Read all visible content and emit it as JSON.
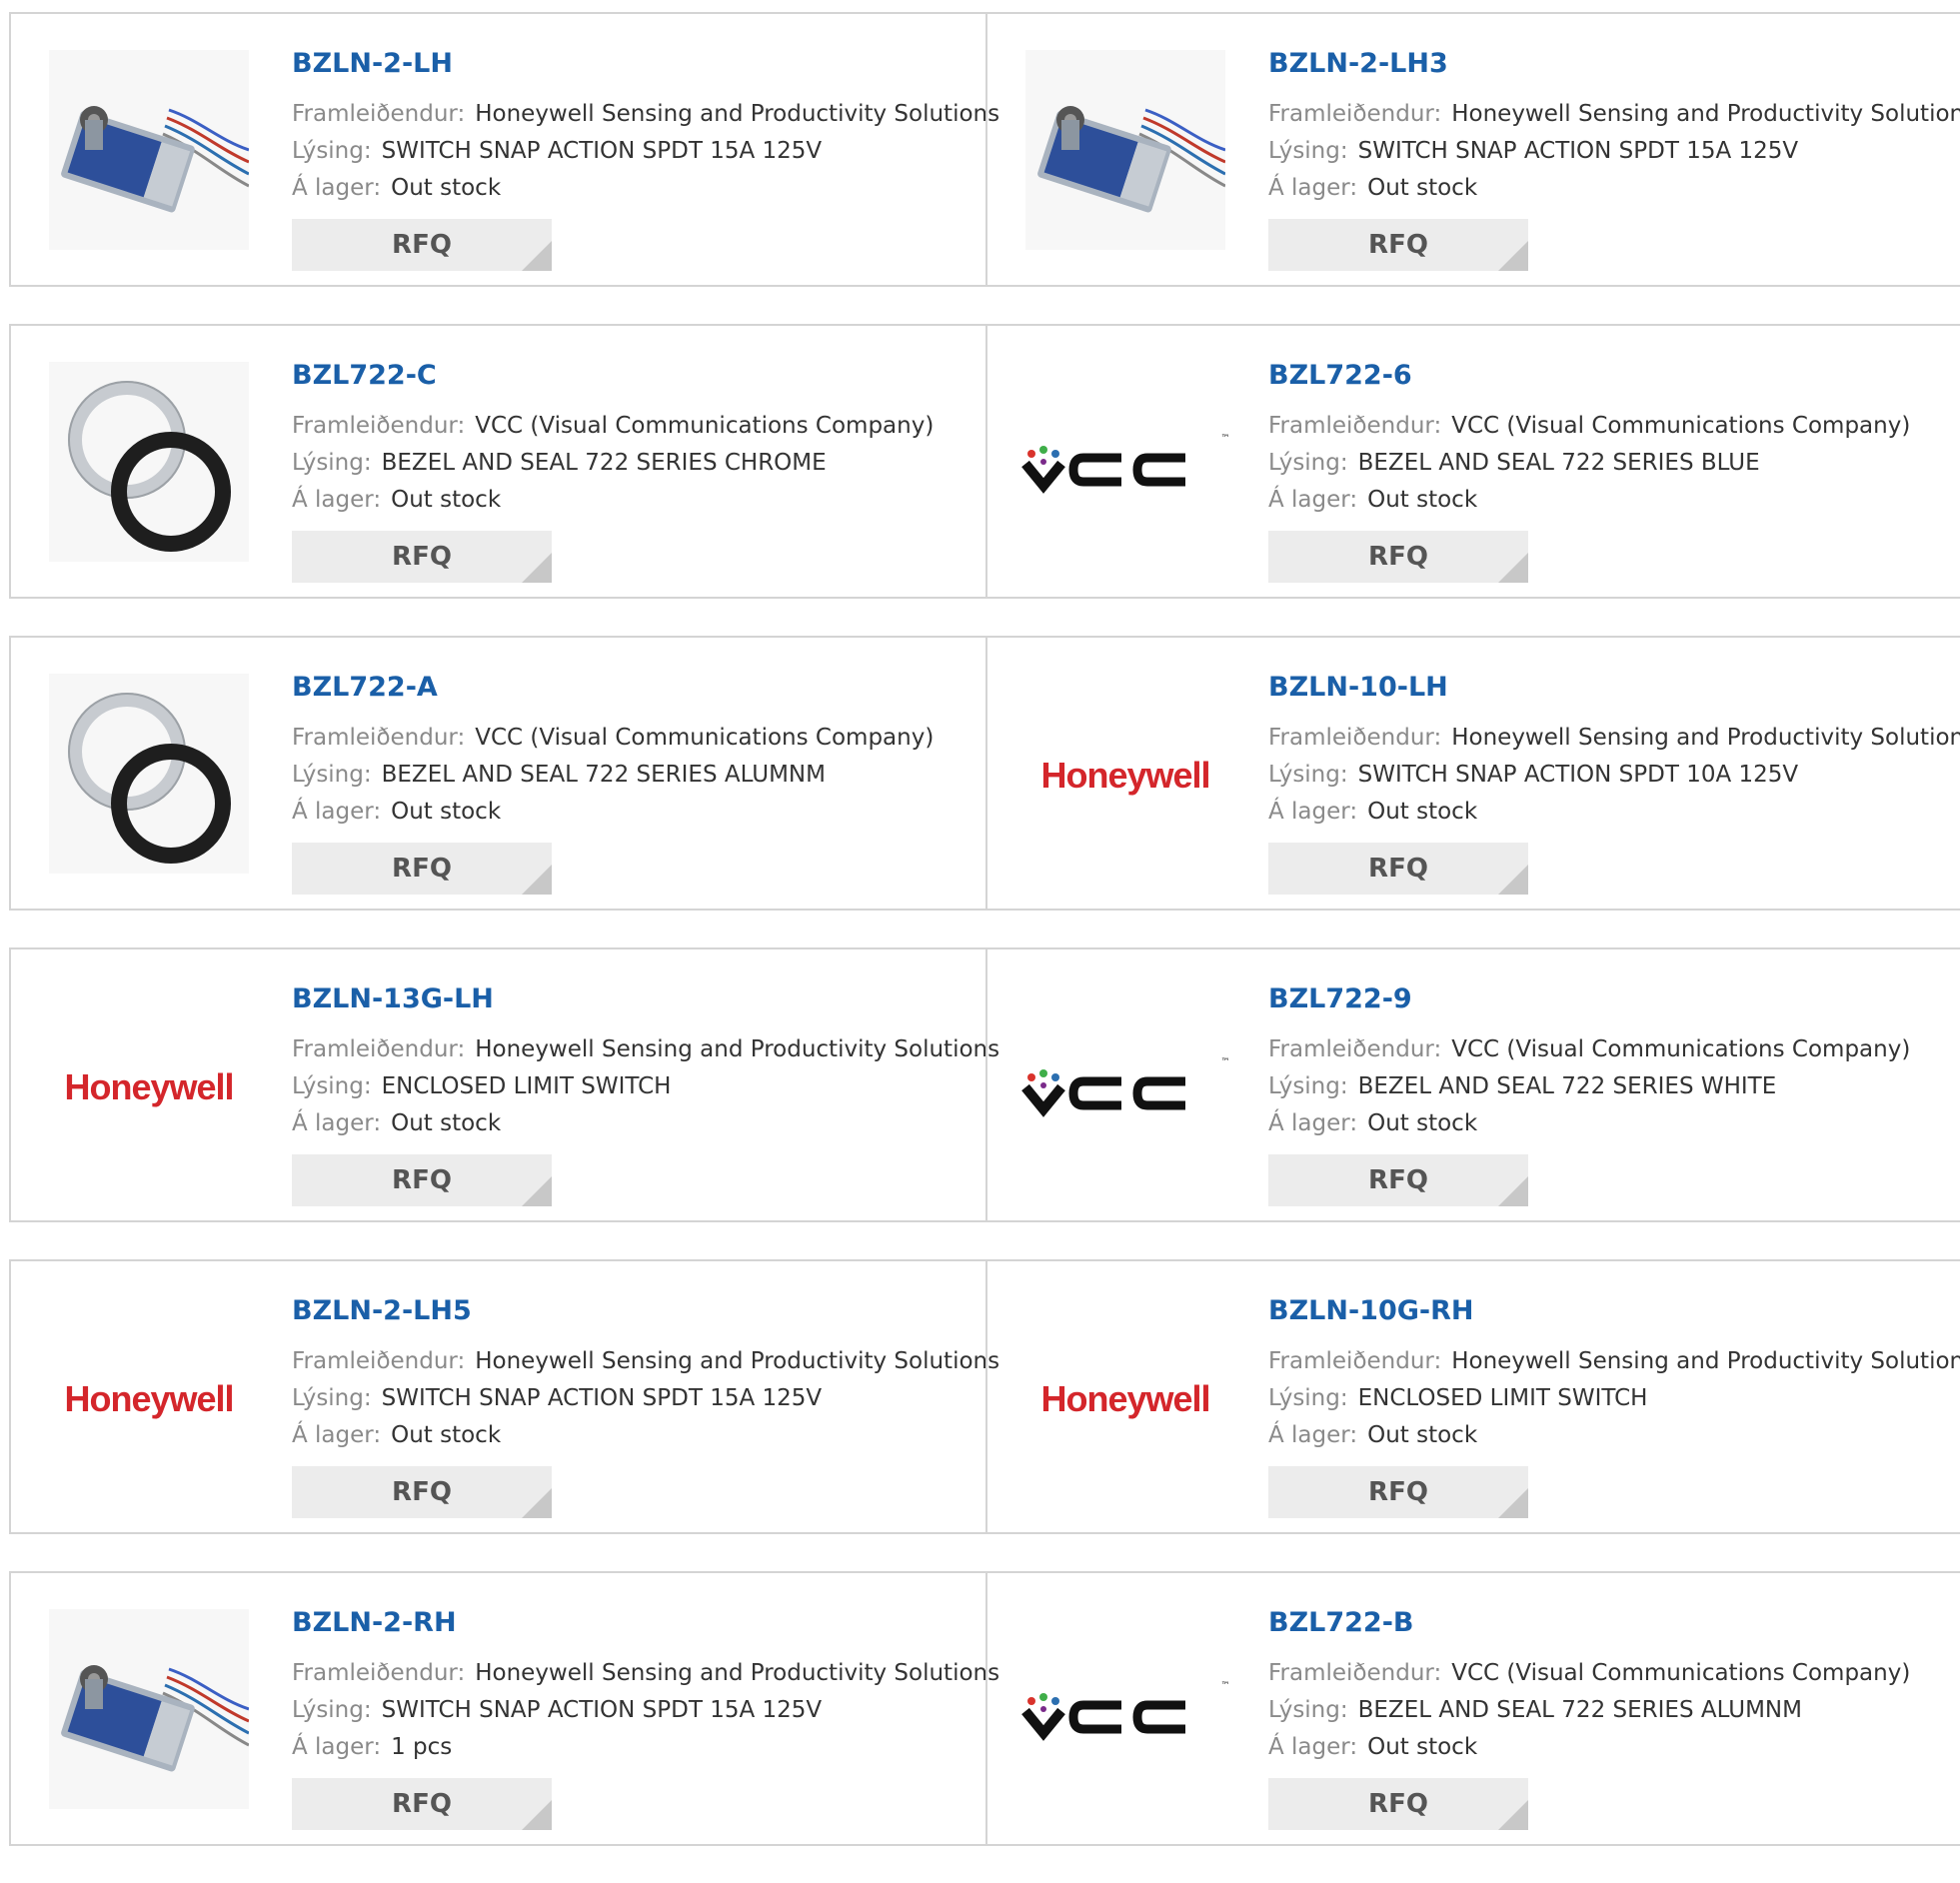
{
  "labels": {
    "manufacturer": "Framleiðendur:",
    "description": "Lýsing:",
    "stock": "Á lager:",
    "rfq": "RFQ"
  },
  "logos": {
    "honeywell": "Honeywell",
    "vcc_tm": "™"
  },
  "colors": {
    "part_link": "#1a5fa8",
    "honeywell_red": "#d4262b",
    "rfq_bg": "#ececec",
    "border": "#d4d4d4"
  },
  "products": [
    {
      "pn": "BZLN-2-LH",
      "manufacturer": "Honeywell Sensing and Productivity Solutions",
      "description": "SWITCH SNAP ACTION SPDT 15A 125V",
      "stock": "Out stock",
      "image": "switch-photo"
    },
    {
      "pn": "BZLN-2-LH3",
      "manufacturer": "Honeywell Sensing and Productivity Solutions",
      "description": "SWITCH SNAP ACTION SPDT 15A 125V",
      "stock": "Out stock",
      "image": "switch-photo"
    },
    {
      "pn": "BZL722-C",
      "manufacturer": "VCC (Visual Communications Company)",
      "description": "BEZEL AND SEAL 722 SERIES CHROME",
      "stock": "Out stock",
      "image": "bezel-photo"
    },
    {
      "pn": "BZL722-6",
      "manufacturer": "VCC (Visual Communications Company)",
      "description": "BEZEL AND SEAL 722 SERIES BLUE",
      "stock": "Out stock",
      "image": "vcc-logo"
    },
    {
      "pn": "BZL722-A",
      "manufacturer": "VCC (Visual Communications Company)",
      "description": "BEZEL AND SEAL 722 SERIES ALUMNM",
      "stock": "Out stock",
      "image": "bezel-photo"
    },
    {
      "pn": "BZLN-10-LH",
      "manufacturer": "Honeywell Sensing and Productivity Solutions",
      "description": "SWITCH SNAP ACTION SPDT 10A 125V",
      "stock": "Out stock",
      "image": "honeywell-logo"
    },
    {
      "pn": "BZLN-13G-LH",
      "manufacturer": "Honeywell Sensing and Productivity Solutions",
      "description": "ENCLOSED LIMIT SWITCH",
      "stock": "Out stock",
      "image": "honeywell-logo"
    },
    {
      "pn": "BZL722-9",
      "manufacturer": "VCC (Visual Communications Company)",
      "description": "BEZEL AND SEAL 722 SERIES WHITE",
      "stock": "Out stock",
      "image": "vcc-logo"
    },
    {
      "pn": "BZLN-2-LH5",
      "manufacturer": "Honeywell Sensing and Productivity Solutions",
      "description": "SWITCH SNAP ACTION SPDT 15A 125V",
      "stock": "Out stock",
      "image": "honeywell-logo"
    },
    {
      "pn": "BZLN-10G-RH",
      "manufacturer": "Honeywell Sensing and Productivity Solutions",
      "description": "ENCLOSED LIMIT SWITCH",
      "stock": "Out stock",
      "image": "honeywell-logo"
    },
    {
      "pn": "BZLN-2-RH",
      "manufacturer": "Honeywell Sensing and Productivity Solutions",
      "description": "SWITCH SNAP ACTION SPDT 15A 125V",
      "stock": "1 pcs",
      "image": "switch-photo"
    },
    {
      "pn": "BZL722-B",
      "manufacturer": "VCC (Visual Communications Company)",
      "description": "BEZEL AND SEAL 722 SERIES ALUMNM",
      "stock": "Out stock",
      "image": "vcc-logo"
    }
  ]
}
